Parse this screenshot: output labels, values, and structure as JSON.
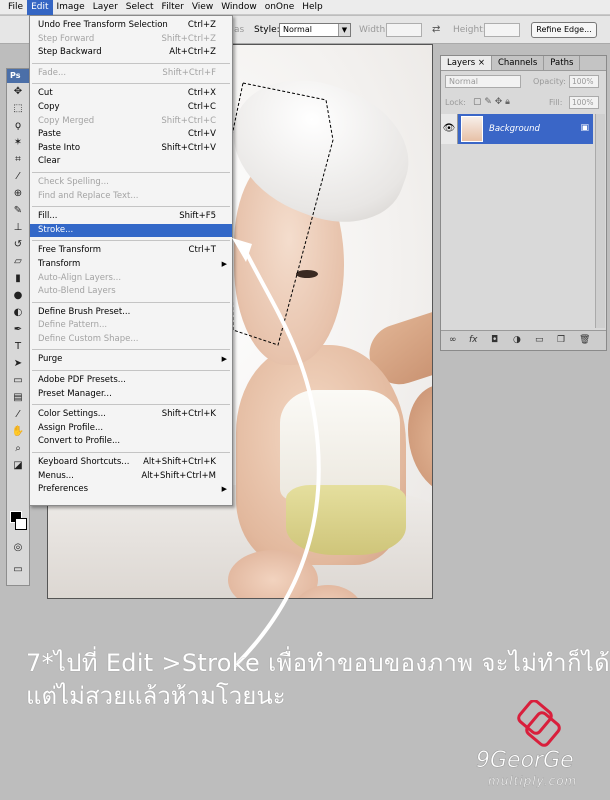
{
  "menubar": [
    "File",
    "Edit",
    "Image",
    "Layer",
    "Select",
    "Filter",
    "View",
    "Window",
    "onOne",
    "Help"
  ],
  "options": {
    "dim_label": "as",
    "style_label": "Style:",
    "style_value": "Normal",
    "width_label": "Width:",
    "height_label": "Height:",
    "refine_button": "Refine Edge..."
  },
  "tools_header": "Ps",
  "edit_menu": {
    "undo": {
      "label": "Undo Free Transform Selection",
      "shortcut": "Ctrl+Z"
    },
    "step_forward": {
      "label": "Step Forward",
      "shortcut": "Shift+Ctrl+Z"
    },
    "step_backward": {
      "label": "Step Backward",
      "shortcut": "Alt+Ctrl+Z"
    },
    "fade": {
      "label": "Fade...",
      "shortcut": "Shift+Ctrl+F"
    },
    "cut": {
      "label": "Cut",
      "shortcut": "Ctrl+X"
    },
    "copy": {
      "label": "Copy",
      "shortcut": "Ctrl+C"
    },
    "copy_merged": {
      "label": "Copy Merged",
      "shortcut": "Shift+Ctrl+C"
    },
    "paste": {
      "label": "Paste",
      "shortcut": "Ctrl+V"
    },
    "paste_into": {
      "label": "Paste Into",
      "shortcut": "Shift+Ctrl+V"
    },
    "clear": {
      "label": "Clear"
    },
    "check_spelling": {
      "label": "Check Spelling..."
    },
    "find_replace": {
      "label": "Find and Replace Text..."
    },
    "fill": {
      "label": "Fill...",
      "shortcut": "Shift+F5"
    },
    "stroke": {
      "label": "Stroke..."
    },
    "free_transform": {
      "label": "Free Transform",
      "shortcut": "Ctrl+T"
    },
    "transform": {
      "label": "Transform"
    },
    "auto_align": {
      "label": "Auto-Align Layers..."
    },
    "auto_blend": {
      "label": "Auto-Blend Layers"
    },
    "define_brush": {
      "label": "Define Brush Preset..."
    },
    "define_pattern": {
      "label": "Define Pattern..."
    },
    "define_shape": {
      "label": "Define Custom Shape..."
    },
    "purge": {
      "label": "Purge"
    },
    "pdf_presets": {
      "label": "Adobe PDF Presets..."
    },
    "preset_manager": {
      "label": "Preset Manager..."
    },
    "color_settings": {
      "label": "Color Settings...",
      "shortcut": "Shift+Ctrl+K"
    },
    "assign_profile": {
      "label": "Assign Profile..."
    },
    "convert_profile": {
      "label": "Convert to Profile..."
    },
    "keyboard_shortcuts": {
      "label": "Keyboard Shortcuts...",
      "shortcut": "Alt+Shift+Ctrl+K"
    },
    "menus": {
      "label": "Menus...",
      "shortcut": "Alt+Shift+Ctrl+M"
    },
    "preferences": {
      "label": "Preferences"
    }
  },
  "layers_panel": {
    "tabs": [
      "Layers",
      "Channels",
      "Paths"
    ],
    "blend_mode": "Normal",
    "opacity_label": "Opacity:",
    "opacity_value": "100%",
    "lock_label": "Lock:",
    "fill_label": "Fill:",
    "fill_value": "100%",
    "layer_name": "Background"
  },
  "caption": {
    "line1": "7*ไปที่ Edit >Stroke เพื่อทำขอบของภาพ จะไม่ทำก็ได้",
    "line2": "แต่ไม่สวยแล้วห้ามโวยนะ"
  },
  "logo": {
    "name": "9GeorGe",
    "sub": "multiply.com"
  },
  "colors": {
    "menu_highlight": "#3368c8",
    "layer_selected": "#3a66c7",
    "logo_accent": "#d91f3c"
  }
}
